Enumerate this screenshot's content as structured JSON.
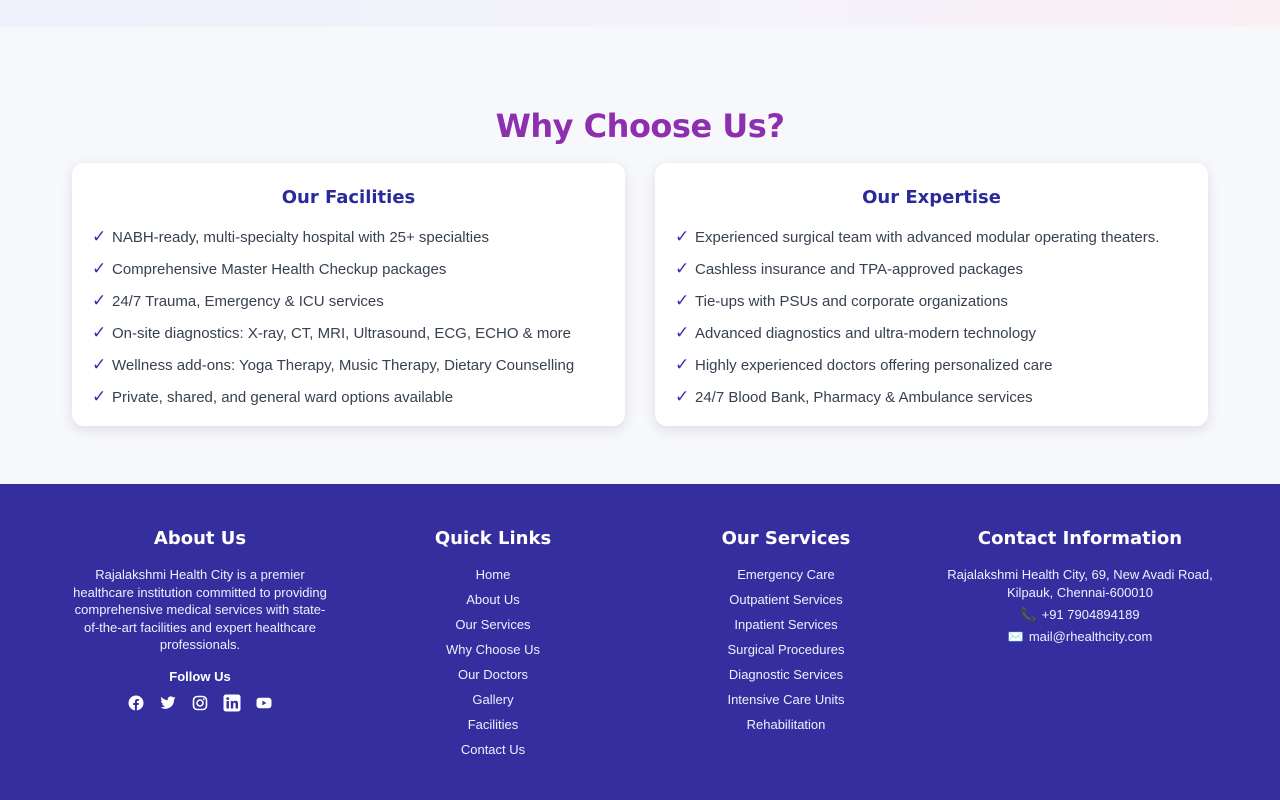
{
  "why": {
    "title": "Why Choose Us?",
    "facilities": {
      "title": "Our Facilities",
      "items": [
        "NABH-ready, multi-specialty hospital with 25+ specialties",
        "Comprehensive Master Health Checkup packages",
        "24/7 Trauma, Emergency & ICU services",
        "On-site diagnostics: X-ray, CT, MRI, Ultrasound, ECG, ECHO & more",
        "Wellness add-ons: Yoga Therapy, Music Therapy, Dietary Counselling",
        "Private, shared, and general ward options available"
      ]
    },
    "expertise": {
      "title": "Our Expertise",
      "items": [
        "Experienced surgical team with advanced modular operating theaters.",
        "Cashless insurance and TPA-approved packages",
        "Tie-ups with PSUs and corporate organizations",
        "Advanced diagnostics and ultra-modern technology",
        "Highly experienced doctors offering personalized care",
        "24/7 Blood Bank, Pharmacy & Ambulance services"
      ]
    },
    "check_symbol": "✓"
  },
  "footer": {
    "about": {
      "title": "About Us",
      "text": "Rajalakshmi Health City is a premier healthcare institution committed to providing comprehensive medical services with state-of-the-art facilities and expert healthcare professionals.",
      "follow_label": "Follow Us",
      "socials": [
        "facebook-icon",
        "twitter-icon",
        "instagram-icon",
        "linkedin-icon",
        "youtube-icon"
      ]
    },
    "quick_links": {
      "title": "Quick Links",
      "items": [
        "Home",
        "About Us",
        "Our Services",
        "Why Choose Us",
        "Our Doctors",
        "Gallery",
        "Facilities",
        "Contact Us"
      ]
    },
    "services": {
      "title": "Our Services",
      "items": [
        "Emergency Care",
        "Outpatient Services",
        "Inpatient Services",
        "Surgical Procedures",
        "Diagnostic Services",
        "Intensive Care Units",
        "Rehabilitation"
      ]
    },
    "contact": {
      "title": "Contact Information",
      "address": "Rajalakshmi Health City, 69, New Avadi Road, Kilpauk, Chennai-600010",
      "phone_icon": "📞",
      "phone": "+91 7904894189",
      "email_icon": "✉️",
      "email": "mail@rhealthcity.com"
    }
  },
  "colors": {
    "title_purple": "#8e2fb0",
    "card_title_navy": "#2a2a9a",
    "footer_bg": "#342e9e"
  }
}
